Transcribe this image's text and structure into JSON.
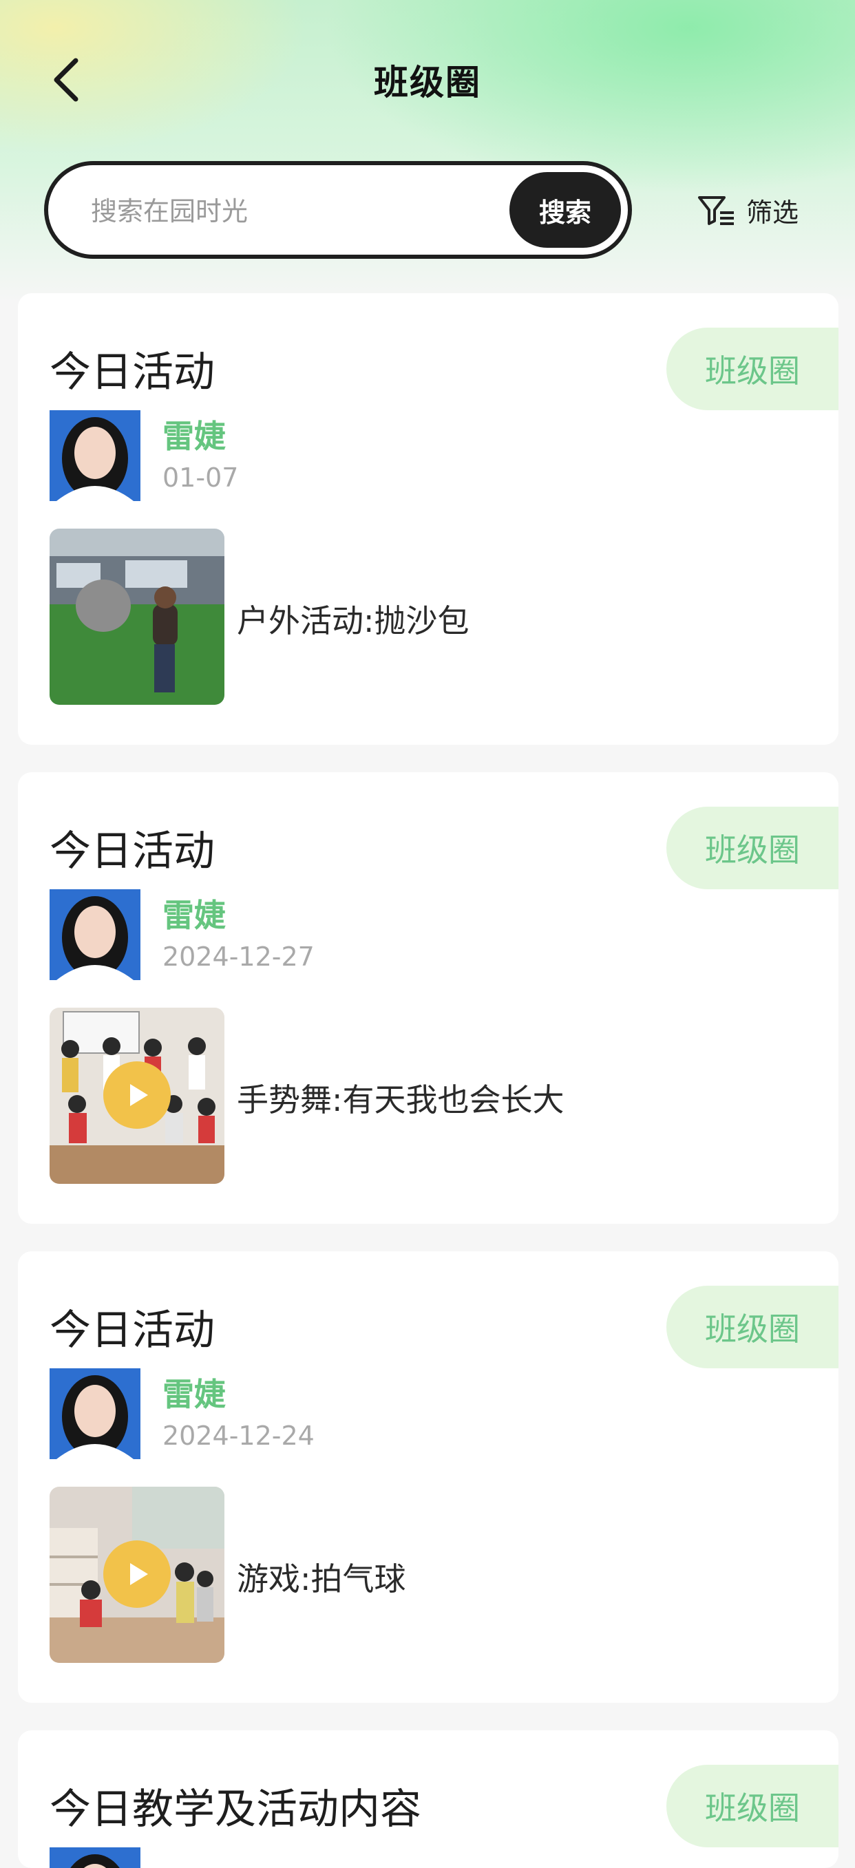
{
  "header": {
    "title": "班级圈"
  },
  "search": {
    "placeholder": "搜索在园时光",
    "button_label": "搜索"
  },
  "filter": {
    "label": "筛选"
  },
  "posts": [
    {
      "title": "今日活动",
      "tag": "班级圈",
      "author": "雷婕",
      "date": "01-07",
      "caption": "户外活动:抛沙包",
      "has_video": false
    },
    {
      "title": "今日活动",
      "tag": "班级圈",
      "author": "雷婕",
      "date": "2024-12-27",
      "caption": "手势舞:有天我也会长大",
      "has_video": true
    },
    {
      "title": "今日活动",
      "tag": "班级圈",
      "author": "雷婕",
      "date": "2024-12-24",
      "caption": "游戏:拍气球",
      "has_video": true
    },
    {
      "title": "今日教学及活动内容",
      "tag": "班级圈"
    }
  ],
  "colors": {
    "accent_green": "#65c57f",
    "tag_bg": "#e4f6df",
    "play_button": "#f2c24a",
    "search_button_bg": "#1f1f1f"
  },
  "icons": {
    "back": "chevron-left-icon",
    "filter": "filter-icon",
    "play": "play-icon"
  }
}
